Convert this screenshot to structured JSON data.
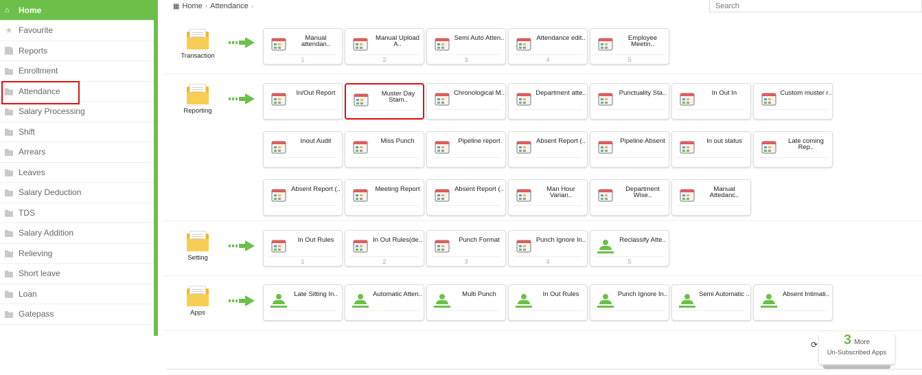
{
  "sidebar": {
    "items": [
      {
        "label": "Home",
        "icon": "home-icon"
      },
      {
        "label": "Favourite",
        "icon": "star-icon"
      },
      {
        "label": "Reports",
        "icon": "file-icon"
      },
      {
        "label": "Enrollment",
        "icon": "folder-icon"
      },
      {
        "label": "Attendance",
        "icon": "folder-icon"
      },
      {
        "label": "Salary Processing",
        "icon": "folder-icon"
      },
      {
        "label": "Shift",
        "icon": "folder-icon"
      },
      {
        "label": "Arrears",
        "icon": "folder-icon"
      },
      {
        "label": "Leaves",
        "icon": "folder-icon"
      },
      {
        "label": "Salary Deduction",
        "icon": "folder-icon"
      },
      {
        "label": "TDS",
        "icon": "folder-icon"
      },
      {
        "label": "Salary Addition",
        "icon": "folder-icon"
      },
      {
        "label": "Relieving",
        "icon": "folder-icon"
      },
      {
        "label": "Short leave",
        "icon": "folder-icon"
      },
      {
        "label": "Loan",
        "icon": "folder-icon"
      },
      {
        "label": "Gatepass",
        "icon": "folder-icon"
      }
    ]
  },
  "breadcrumb": {
    "home": "Home",
    "current": "Attendance"
  },
  "search": {
    "placeholder": "Search"
  },
  "sections": {
    "transaction": {
      "label": "Transaction",
      "tiles": [
        {
          "label": "Manual attendan..",
          "num": "1"
        },
        {
          "label": "Manual Upload A..",
          "num": "2"
        },
        {
          "label": "Semi Auto Atten..",
          "num": "3"
        },
        {
          "label": "Attendance edit..",
          "num": "4"
        },
        {
          "label": "Employee Meetin..",
          "num": "5"
        }
      ]
    },
    "reporting": {
      "label": "Reporting",
      "tiles": [
        {
          "label": "In/Out Report"
        },
        {
          "label": "Muster Day Stam.."
        },
        {
          "label": "Chronological M.."
        },
        {
          "label": "Department atte.."
        },
        {
          "label": "Punctuality Sta.."
        },
        {
          "label": "In Out In"
        },
        {
          "label": "Custom muster r.."
        },
        {
          "label": "Inout Audit"
        },
        {
          "label": "Miss Punch"
        },
        {
          "label": "Pipeline report"
        },
        {
          "label": "Absent Report (.."
        },
        {
          "label": "Pipeline Absent"
        },
        {
          "label": "In out status"
        },
        {
          "label": "Late coming Rep.."
        },
        {
          "label": "Absent Report (.."
        },
        {
          "label": "Meeting Report"
        },
        {
          "label": "Absent Report (.."
        },
        {
          "label": "Man Hour Varian.."
        },
        {
          "label": "Department Wise.."
        },
        {
          "label": "Manual Attedanc.."
        }
      ]
    },
    "setting": {
      "label": "Setting",
      "tiles": [
        {
          "label": "In Out Rules",
          "num": "1"
        },
        {
          "label": "In Out Rules(de..",
          "num": "2"
        },
        {
          "label": "Punch Format",
          "num": "3"
        },
        {
          "label": "Punch Ignore In..",
          "num": "4"
        },
        {
          "label": "Reclassify Atte..",
          "num": "5"
        }
      ]
    },
    "apps": {
      "label": "Apps",
      "tiles": [
        {
          "label": "Late Sitting In.."
        },
        {
          "label": "Automatic Atten.."
        },
        {
          "label": "Multi Punch"
        },
        {
          "label": "In Out Rules"
        },
        {
          "label": "Punch Ignore In.."
        },
        {
          "label": "Semi Automatic .."
        },
        {
          "label": "Absent Intimati.."
        }
      ]
    }
  },
  "more_apps": {
    "count": "3",
    "more": "More",
    "label": "Un-Subscribed Apps"
  },
  "colors": {
    "accent": "#6cc04a",
    "highlight": "#e01010",
    "folder": "#f3b82d"
  }
}
